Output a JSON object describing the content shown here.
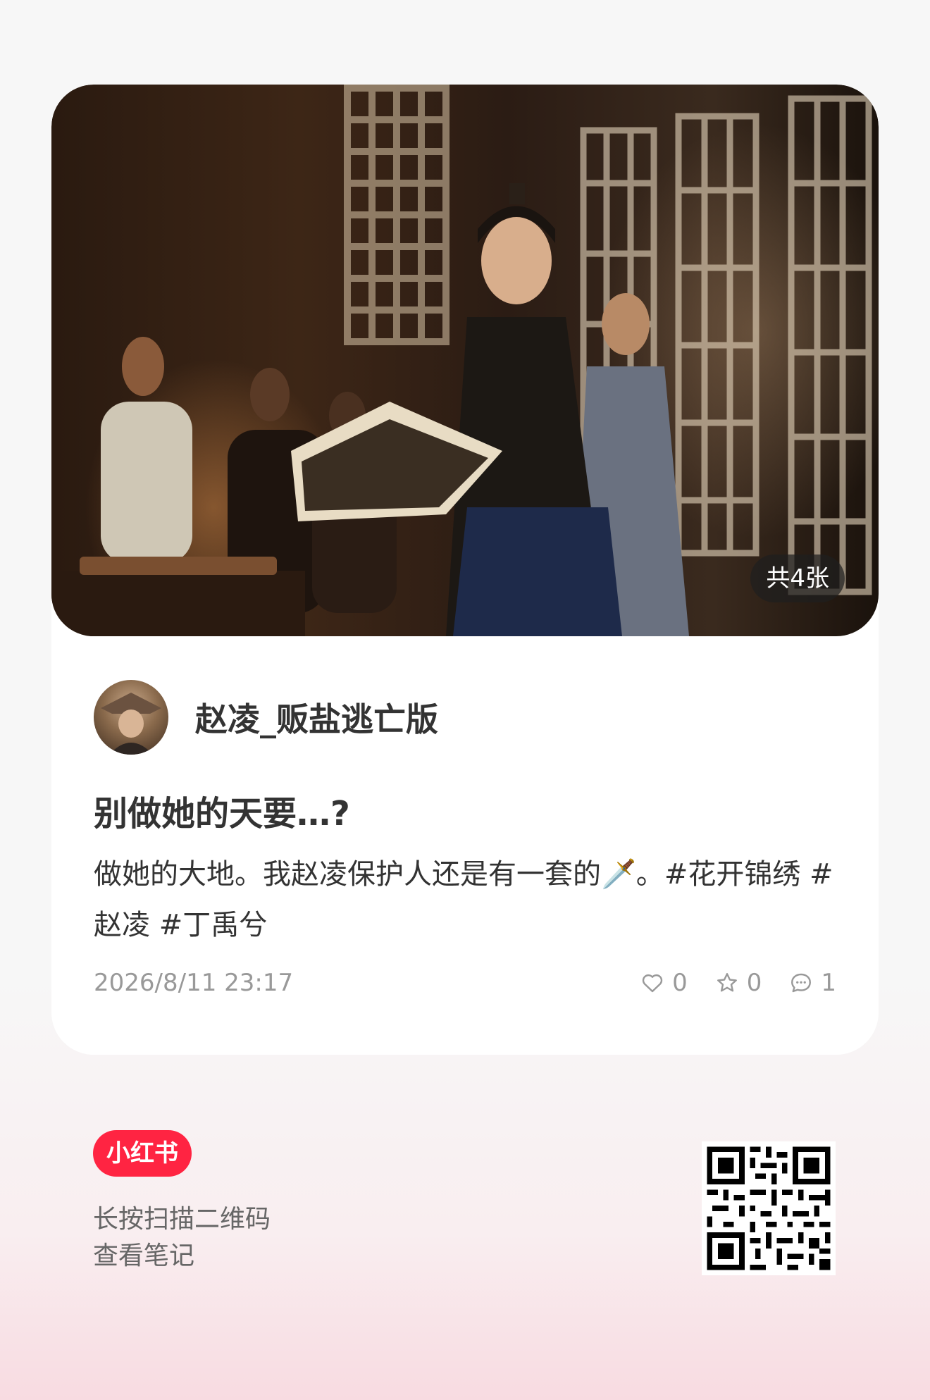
{
  "note": {
    "image_count_badge": "共4张",
    "author": {
      "name": "赵凌_贩盐逃亡版"
    },
    "title": "别做她的天要…?",
    "description": {
      "text": "做她的大地。我赵凌保护人还是有一套的🗡️。",
      "tags": [
        "#花开锦绣",
        "#赵凌",
        "#丁禹兮"
      ]
    },
    "datetime": "2026/8/11 23:17",
    "stats": {
      "likes": "0",
      "favorites": "0",
      "comments": "1"
    }
  },
  "footer": {
    "brand": "小红书",
    "hint_line1": "长按扫描二维码",
    "hint_line2": "查看笔记"
  },
  "colors": {
    "brand_red": "#ff2442",
    "text_primary": "#333333",
    "text_secondary": "#999999"
  }
}
